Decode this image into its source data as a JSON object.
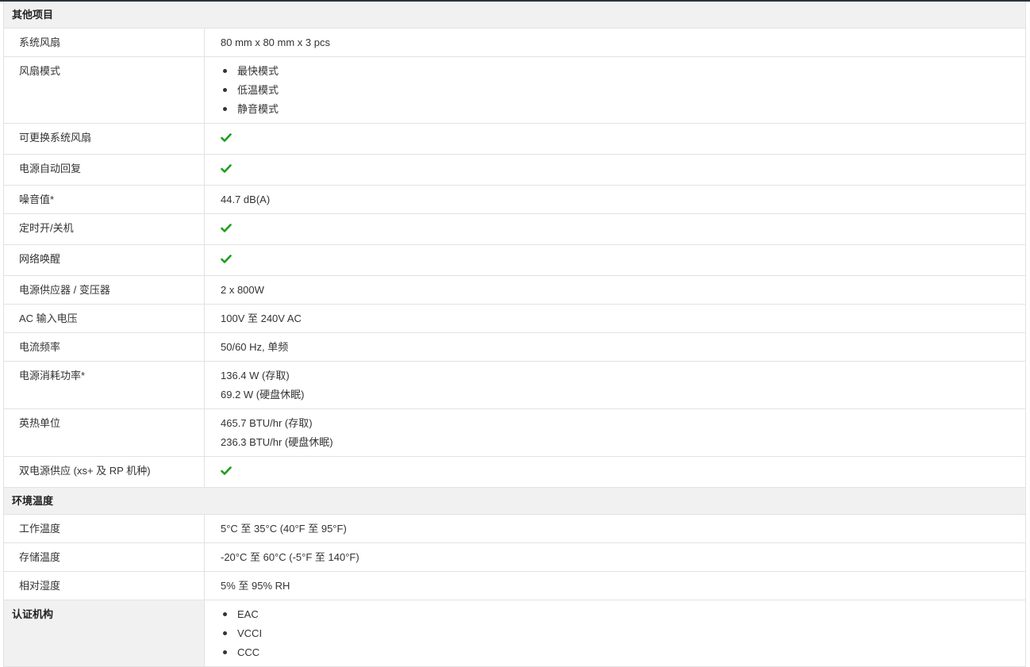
{
  "sections": {
    "other": "其他项目",
    "environment": "环境温度"
  },
  "rows": {
    "fan": {
      "label": "系统风扇",
      "value": "80 mm x 80 mm x 3 pcs"
    },
    "fan_mode": {
      "label": "风扇模式",
      "items": [
        "最快模式",
        "低温模式",
        "静音模式"
      ]
    },
    "replaceable_fan": {
      "label": "可更换系统风扇",
      "supported": true
    },
    "power_recovery": {
      "label": "电源自动回复",
      "supported": true
    },
    "noise": {
      "label": "噪音值*",
      "value": "44.7 dB(A)"
    },
    "scheduled_power": {
      "label": "定时开/关机",
      "supported": true
    },
    "wake_on_lan": {
      "label": "网络唤醒",
      "supported": true
    },
    "psu": {
      "label": "电源供应器 / 变压器",
      "value": "2 x 800W"
    },
    "ac_voltage": {
      "label": "AC 输入电压",
      "value": "100V 至 240V AC"
    },
    "frequency": {
      "label": "电流频率",
      "value": "50/60 Hz, 单频"
    },
    "power_consumption": {
      "label": "电源消耗功率*",
      "lines": [
        "136.4 W (存取)",
        "69.2 W (硬盘休眠)"
      ]
    },
    "btu": {
      "label": "英热单位",
      "lines": [
        "465.7 BTU/hr (存取)",
        "236.3 BTU/hr (硬盘休眠)"
      ]
    },
    "dual_psu": {
      "label": "双电源供应 (xs+ 及 RP 机种)",
      "supported": true
    },
    "operating_temp": {
      "label": "工作温度",
      "value": "5°C 至 35°C (40°F 至 95°F)"
    },
    "storage_temp": {
      "label": "存储温度",
      "value": "-20°C 至 60°C (-5°F 至 140°F)"
    },
    "humidity": {
      "label": "相对湿度",
      "value": "5% 至 95% RH"
    },
    "certification": {
      "label": "认证机构",
      "items": [
        "EAC",
        "VCCI",
        "CCC"
      ]
    }
  },
  "icons": {
    "check": "checkmark-icon"
  },
  "colors": {
    "check": "#1e9e1e",
    "section_bg": "#f1f1f1",
    "border": "#e2e2e2"
  }
}
